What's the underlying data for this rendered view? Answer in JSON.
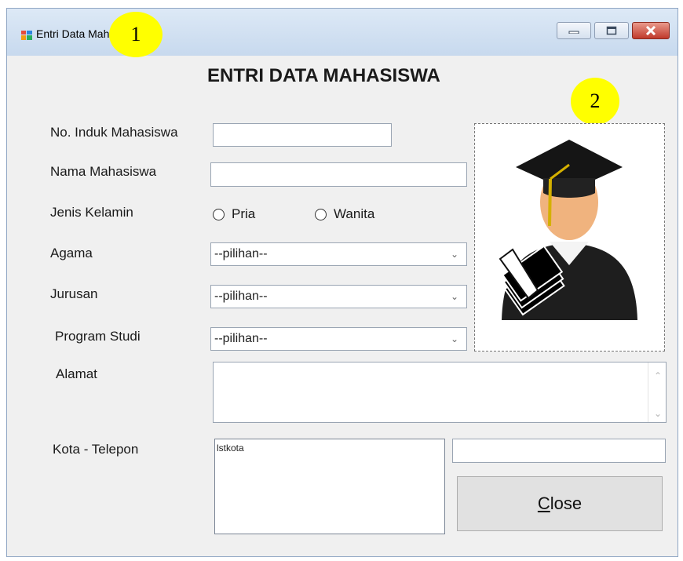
{
  "window": {
    "title": "Entri Data Mahasiswa"
  },
  "badges": {
    "one": "1",
    "two": "2"
  },
  "form": {
    "heading": "ENTRI DATA MAHASISWA",
    "nim_label": "No. Induk Mahasiswa",
    "nim_value": "",
    "nama_label": "Nama Mahasiswa",
    "nama_value": "",
    "gender_label": "Jenis Kelamin",
    "gender_options": [
      "Pria",
      "Wanita"
    ],
    "agama_label": "Agama",
    "agama_value": "--pilihan--",
    "jurusan_label": "Jurusan",
    "jurusan_value": "--pilihan--",
    "prodi_label": "Program Studi",
    "prodi_value": "--pilihan--",
    "alamat_label": "Alamat",
    "alamat_value": "",
    "kota_label": "Kota - Telepon",
    "kota_list_items": [
      "lstkota"
    ],
    "telepon_value": "",
    "close_mnemonic": "C",
    "close_rest": "lose"
  },
  "icons": {
    "app": "form-icon",
    "photo": "graduate-avatar-icon",
    "chevron": "chevron-down-icon"
  },
  "colors": {
    "badge": "#ffff00",
    "close_button_red": "#c0392b",
    "form_background": "#f0f0f0"
  }
}
